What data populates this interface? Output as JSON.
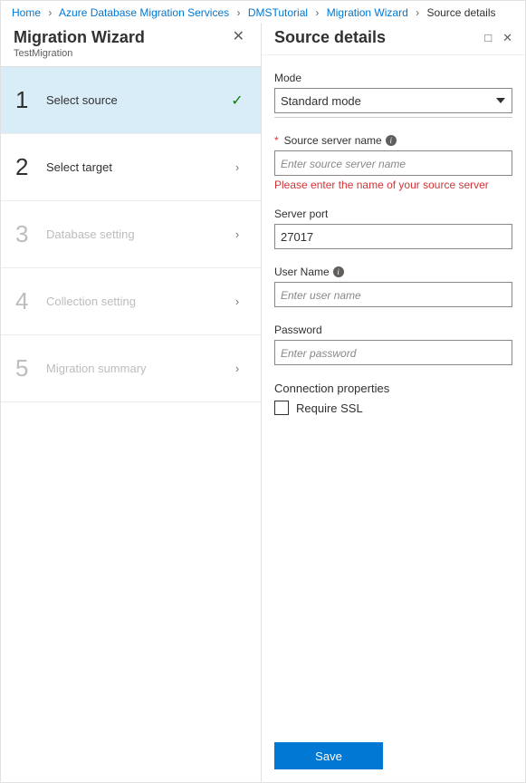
{
  "breadcrumb": {
    "items": [
      {
        "label": "Home"
      },
      {
        "label": "Azure Database Migration Services"
      },
      {
        "label": "DMSTutorial"
      },
      {
        "label": "Migration Wizard"
      }
    ],
    "current": "Source details"
  },
  "wizard": {
    "title": "Migration Wizard",
    "subtitle": "TestMigration",
    "steps": [
      {
        "num": "1",
        "label": "Select source",
        "state": "active",
        "indicator": "check"
      },
      {
        "num": "2",
        "label": "Select target",
        "state": "enabled",
        "indicator": "chev"
      },
      {
        "num": "3",
        "label": "Database setting",
        "state": "disabled",
        "indicator": "chev"
      },
      {
        "num": "4",
        "label": "Collection setting",
        "state": "disabled",
        "indicator": "chev"
      },
      {
        "num": "5",
        "label": "Migration summary",
        "state": "disabled",
        "indicator": "chev"
      }
    ]
  },
  "details": {
    "title": "Source details",
    "mode": {
      "label": "Mode",
      "value": "Standard mode"
    },
    "source_server": {
      "label": "Source server name",
      "placeholder": "Enter source server name",
      "value": "",
      "error": "Please enter the name of your source server"
    },
    "server_port": {
      "label": "Server port",
      "value": "27017"
    },
    "user_name": {
      "label": "User Name",
      "placeholder": "Enter user name",
      "value": ""
    },
    "password": {
      "label": "Password",
      "placeholder": "Enter password",
      "value": ""
    },
    "connection": {
      "label": "Connection properties",
      "require_ssl_label": "Require SSL",
      "require_ssl_checked": false
    },
    "save_label": "Save"
  }
}
